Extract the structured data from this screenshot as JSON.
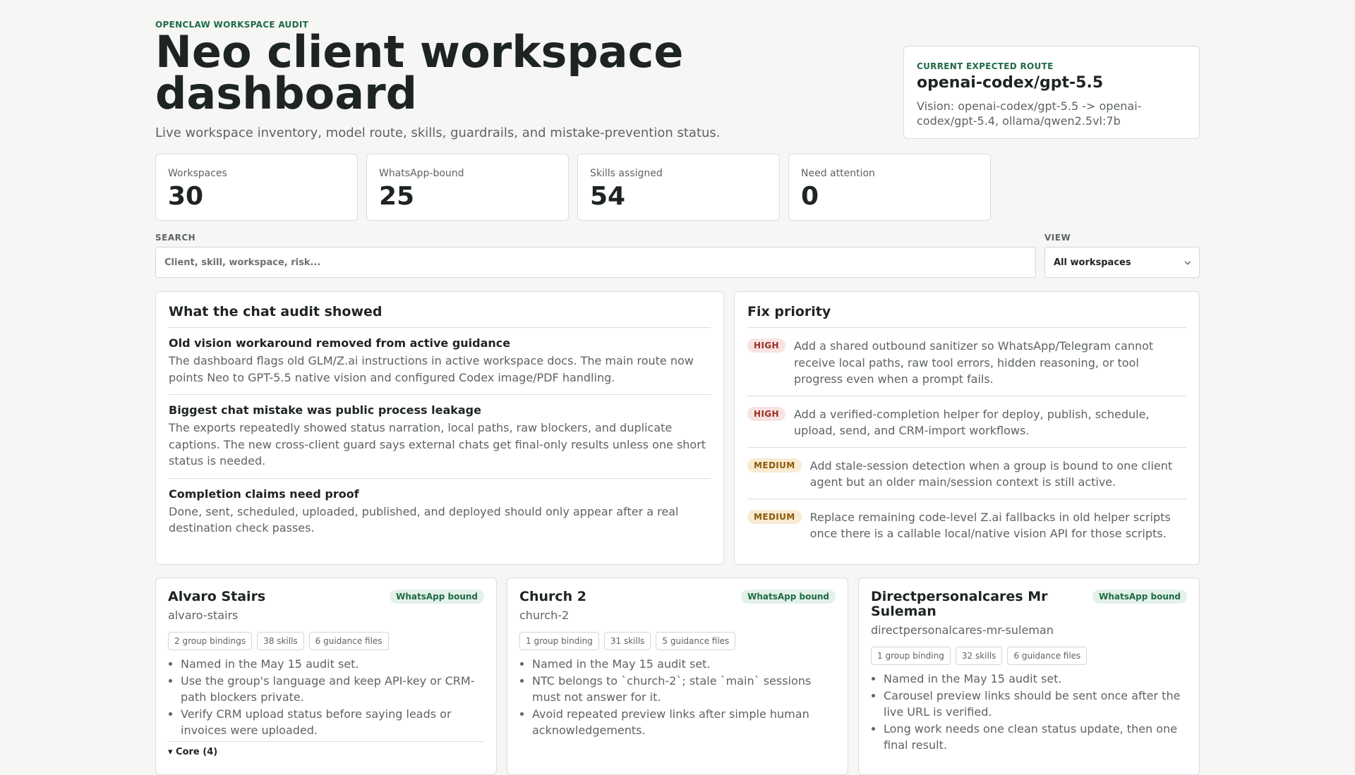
{
  "header": {
    "eyebrow": "OPENCLAW WORKSPACE AUDIT",
    "title": "Neo client workspace dashboard",
    "subtitle": "Live workspace inventory, model route, skills, guardrails, and mistake-prevention status."
  },
  "route": {
    "label": "CURRENT EXPECTED ROUTE",
    "value": "openai-codex/gpt-5.5",
    "vision": "Vision: openai-codex/gpt-5.5 -> openai-codex/gpt-5.4, ollama/qwen2.5vl:7b"
  },
  "stats": [
    {
      "label": "Workspaces",
      "value": "30"
    },
    {
      "label": "WhatsApp-bound",
      "value": "25"
    },
    {
      "label": "Skills assigned",
      "value": "54"
    },
    {
      "label": "Need attention",
      "value": "0"
    }
  ],
  "search": {
    "label": "SEARCH",
    "placeholder": "Client, skill, workspace, risk..."
  },
  "view": {
    "label": "VIEW",
    "selected": "All workspaces"
  },
  "audit": {
    "title": "What the chat audit showed",
    "items": [
      {
        "title": "Old vision workaround removed from active guidance",
        "body": "The dashboard flags old GLM/Z.ai instructions in active workspace docs. The main route now points Neo to GPT-5.5 native vision and configured Codex image/PDF handling."
      },
      {
        "title": "Biggest chat mistake was public process leakage",
        "body": "The exports repeatedly showed status narration, local paths, raw blockers, and duplicate captions. The new cross-client guard says external chats get final-only results unless one short status is needed."
      },
      {
        "title": "Completion claims need proof",
        "body": "Done, sent, scheduled, uploaded, published, and deployed should only appear after a real destination check passes."
      }
    ]
  },
  "fix": {
    "title": "Fix priority",
    "items": [
      {
        "level": "HIGH",
        "text": "Add a shared outbound sanitizer so WhatsApp/Telegram cannot receive local paths, raw tool errors, hidden reasoning, or tool progress even when a prompt fails."
      },
      {
        "level": "HIGH",
        "text": "Add a verified-completion helper for deploy, publish, schedule, upload, send, and CRM-import workflows."
      },
      {
        "level": "MEDIUM",
        "text": "Add stale-session detection when a group is bound to one client agent but an older main/session context is still active."
      },
      {
        "level": "MEDIUM",
        "text": "Replace remaining code-level Z.ai fallbacks in old helper scripts once there is a callable local/native vision API for those scripts."
      }
    ]
  },
  "workspaces": [
    {
      "name": "Alvaro Stairs",
      "badge": "WhatsApp bound",
      "slug": "alvaro-stairs",
      "chips": [
        "2 group bindings",
        "38 skills",
        "6 guidance files"
      ],
      "notes": [
        "Named in the May 15 audit set.",
        "Use the group's language and keep API-key or CRM-path blockers private.",
        "Verify CRM upload status before saying leads or invoices were uploaded."
      ],
      "core": "▾ Core (4)"
    },
    {
      "name": "Church 2",
      "badge": "WhatsApp bound",
      "slug": "church-2",
      "chips": [
        "1 group binding",
        "31 skills",
        "5 guidance files"
      ],
      "notes": [
        "Named in the May 15 audit set.",
        "NTC belongs to `church-2`; stale `main` sessions must not answer for it.",
        "Avoid repeated preview links after simple human acknowledgements."
      ]
    },
    {
      "name": "Directpersonalcares Mr Suleman",
      "badge": "WhatsApp bound",
      "slug": "directpersonalcares-mr-suleman",
      "chips": [
        "1 group binding",
        "32 skills",
        "6 guidance files"
      ],
      "notes": [
        "Named in the May 15 audit set.",
        "Carousel preview links should be sent once after the live URL is verified.",
        "Long work needs one clean status update, then one final result."
      ]
    }
  ]
}
